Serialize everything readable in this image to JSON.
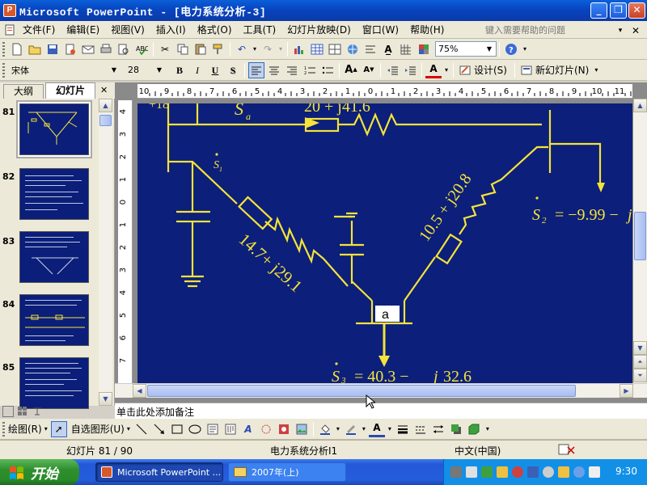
{
  "window": {
    "title": "Microsoft PowerPoint - [电力系统分析-3]",
    "app_icon_letter": "P"
  },
  "menu": {
    "items": [
      "文件(F)",
      "编辑(E)",
      "视图(V)",
      "插入(I)",
      "格式(O)",
      "工具(T)",
      "幻灯片放映(D)",
      "窗口(W)",
      "帮助(H)"
    ],
    "help_placeholder": "键入需要帮助的问题"
  },
  "toolbar": {
    "zoom": "75%"
  },
  "format_toolbar": {
    "font_name": "宋体",
    "font_size": "28",
    "bold": "B",
    "italic": "I",
    "underline": "U",
    "shadow": "S",
    "design_label": "设计(S)",
    "new_slide_label": "新幻灯片(N)"
  },
  "side_panel": {
    "tabs": [
      "大纲",
      "幻灯片"
    ],
    "slides": [
      {
        "number": "81",
        "selected": true
      },
      {
        "number": "82",
        "selected": false
      },
      {
        "number": "83",
        "selected": false
      },
      {
        "number": "84",
        "selected": false
      },
      {
        "number": "85",
        "selected": false
      }
    ]
  },
  "ruler": {
    "labels": [
      "10",
      "9",
      "8",
      "7",
      "6",
      "5",
      "4",
      "3",
      "2",
      "1",
      "0",
      "1",
      "2",
      "3",
      "4",
      "5",
      "6",
      "7",
      "8",
      "9",
      "10",
      "11"
    ]
  },
  "vruler": {
    "labels": [
      "4",
      "3",
      "2",
      "1",
      "0",
      "1",
      "2",
      "3",
      "4",
      "5",
      "6",
      "7"
    ]
  },
  "slide": {
    "node_label": "a",
    "labels": {
      "top_left_fragment": "+18",
      "sa_line": "S",
      "sa_sub": "a",
      "impedance_top": "20 + j41.6",
      "impedance_left": "14.7+ j29.1",
      "impedance_right": "10.5 + j20.8",
      "s1_label": "S",
      "s1_sub": "1",
      "s2_label": "S",
      "s2_sub": "2",
      "s2_value": "= −9.99 −",
      "s2_j": "j",
      "s3_label": "S",
      "s3_sub": "3",
      "s3_value": "= 40.3 −",
      "s3_j": "j",
      "s3_imag": "32.6"
    },
    "colors": {
      "background": "#0c1f7a",
      "line": "#f5e33a"
    }
  },
  "notes": {
    "placeholder": "单击此处添加备注"
  },
  "draw_toolbar": {
    "draw_label": "绘图(R)",
    "autoshape_label": "自选图形(U)"
  },
  "status": {
    "slide_info": "幻灯片 81 / 90",
    "design": "电力系统分析I1",
    "language": "中文(中国)"
  },
  "taskbar": {
    "start_label": "开始",
    "tasks": [
      "Microsoft PowerPoint ...",
      "2007年(上)"
    ],
    "clock": "9:30"
  }
}
